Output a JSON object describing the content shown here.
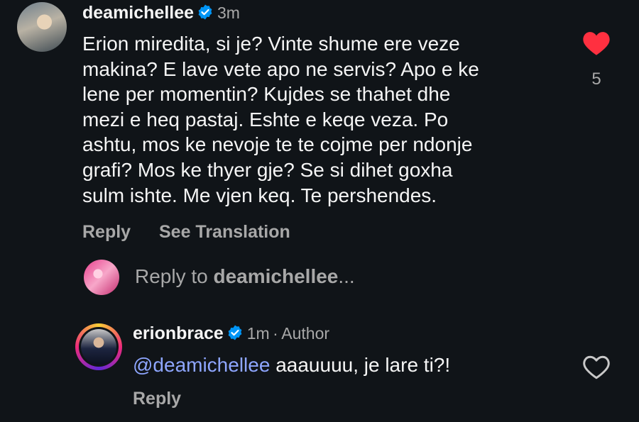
{
  "comment": {
    "username": "deamichellee",
    "time": "3m",
    "text_lines": [
      "Erion miredita, si je? Vinte shume ere veze",
      "makina? E lave vete apo ne servis? Apo e ke",
      "lene per momentin? Kujdes se thahet dhe",
      "mezi e heq pastaj. Eshte e keqe veza. Po",
      "ashtu, mos ke nevoje te te cojme per ndonje",
      "grafi? Mos ke thyer gje? Se si dihet goxha",
      "sulm ishte. Me vjen keq. Te pershendes."
    ],
    "like_count": "5",
    "reply_label": "Reply",
    "translate_label": "See Translation",
    "like_color": "#ff3040"
  },
  "reply_prompt": {
    "prefix": "Reply to ",
    "username": "deamichellee",
    "suffix": "..."
  },
  "reply": {
    "username": "erionbrace",
    "time": "1m",
    "separator": "·",
    "author_label": "Author",
    "mention": "@deamichellee",
    "text": " aaauuuu, je lare ti?!",
    "reply_label": "Reply",
    "mention_color": "#8ea6ff"
  },
  "icons": {
    "verified": "verified-badge-icon",
    "liked": "heart-filled-icon",
    "like": "heart-outline-icon"
  }
}
